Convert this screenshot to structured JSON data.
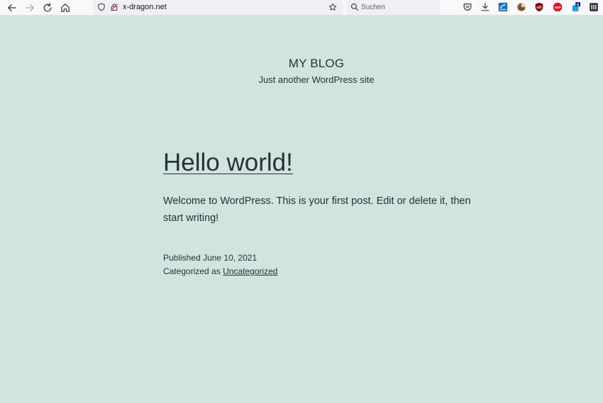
{
  "browser": {
    "url": "x-dragon.net",
    "search_placeholder": "Suchen",
    "extensions": {
      "ublock_label": "uO",
      "abp_label": "ABP",
      "notification_count": "0"
    },
    "colors": {
      "toolbar_bg": "#f9f9fb",
      "urlbar_bg": "#f0f0f4"
    }
  },
  "site": {
    "title": "MY BLOG",
    "description": "Just another WordPress site",
    "background": "#d1e4dd",
    "text_color": "#28303d"
  },
  "post": {
    "title": "Hello world!",
    "body": "Welcome to WordPress. This is your first post. Edit or delete it, then start writing!",
    "published_label": "Published",
    "published_date": "June 10, 2021",
    "category_label": "Categorized as",
    "category": "Uncategorized"
  }
}
